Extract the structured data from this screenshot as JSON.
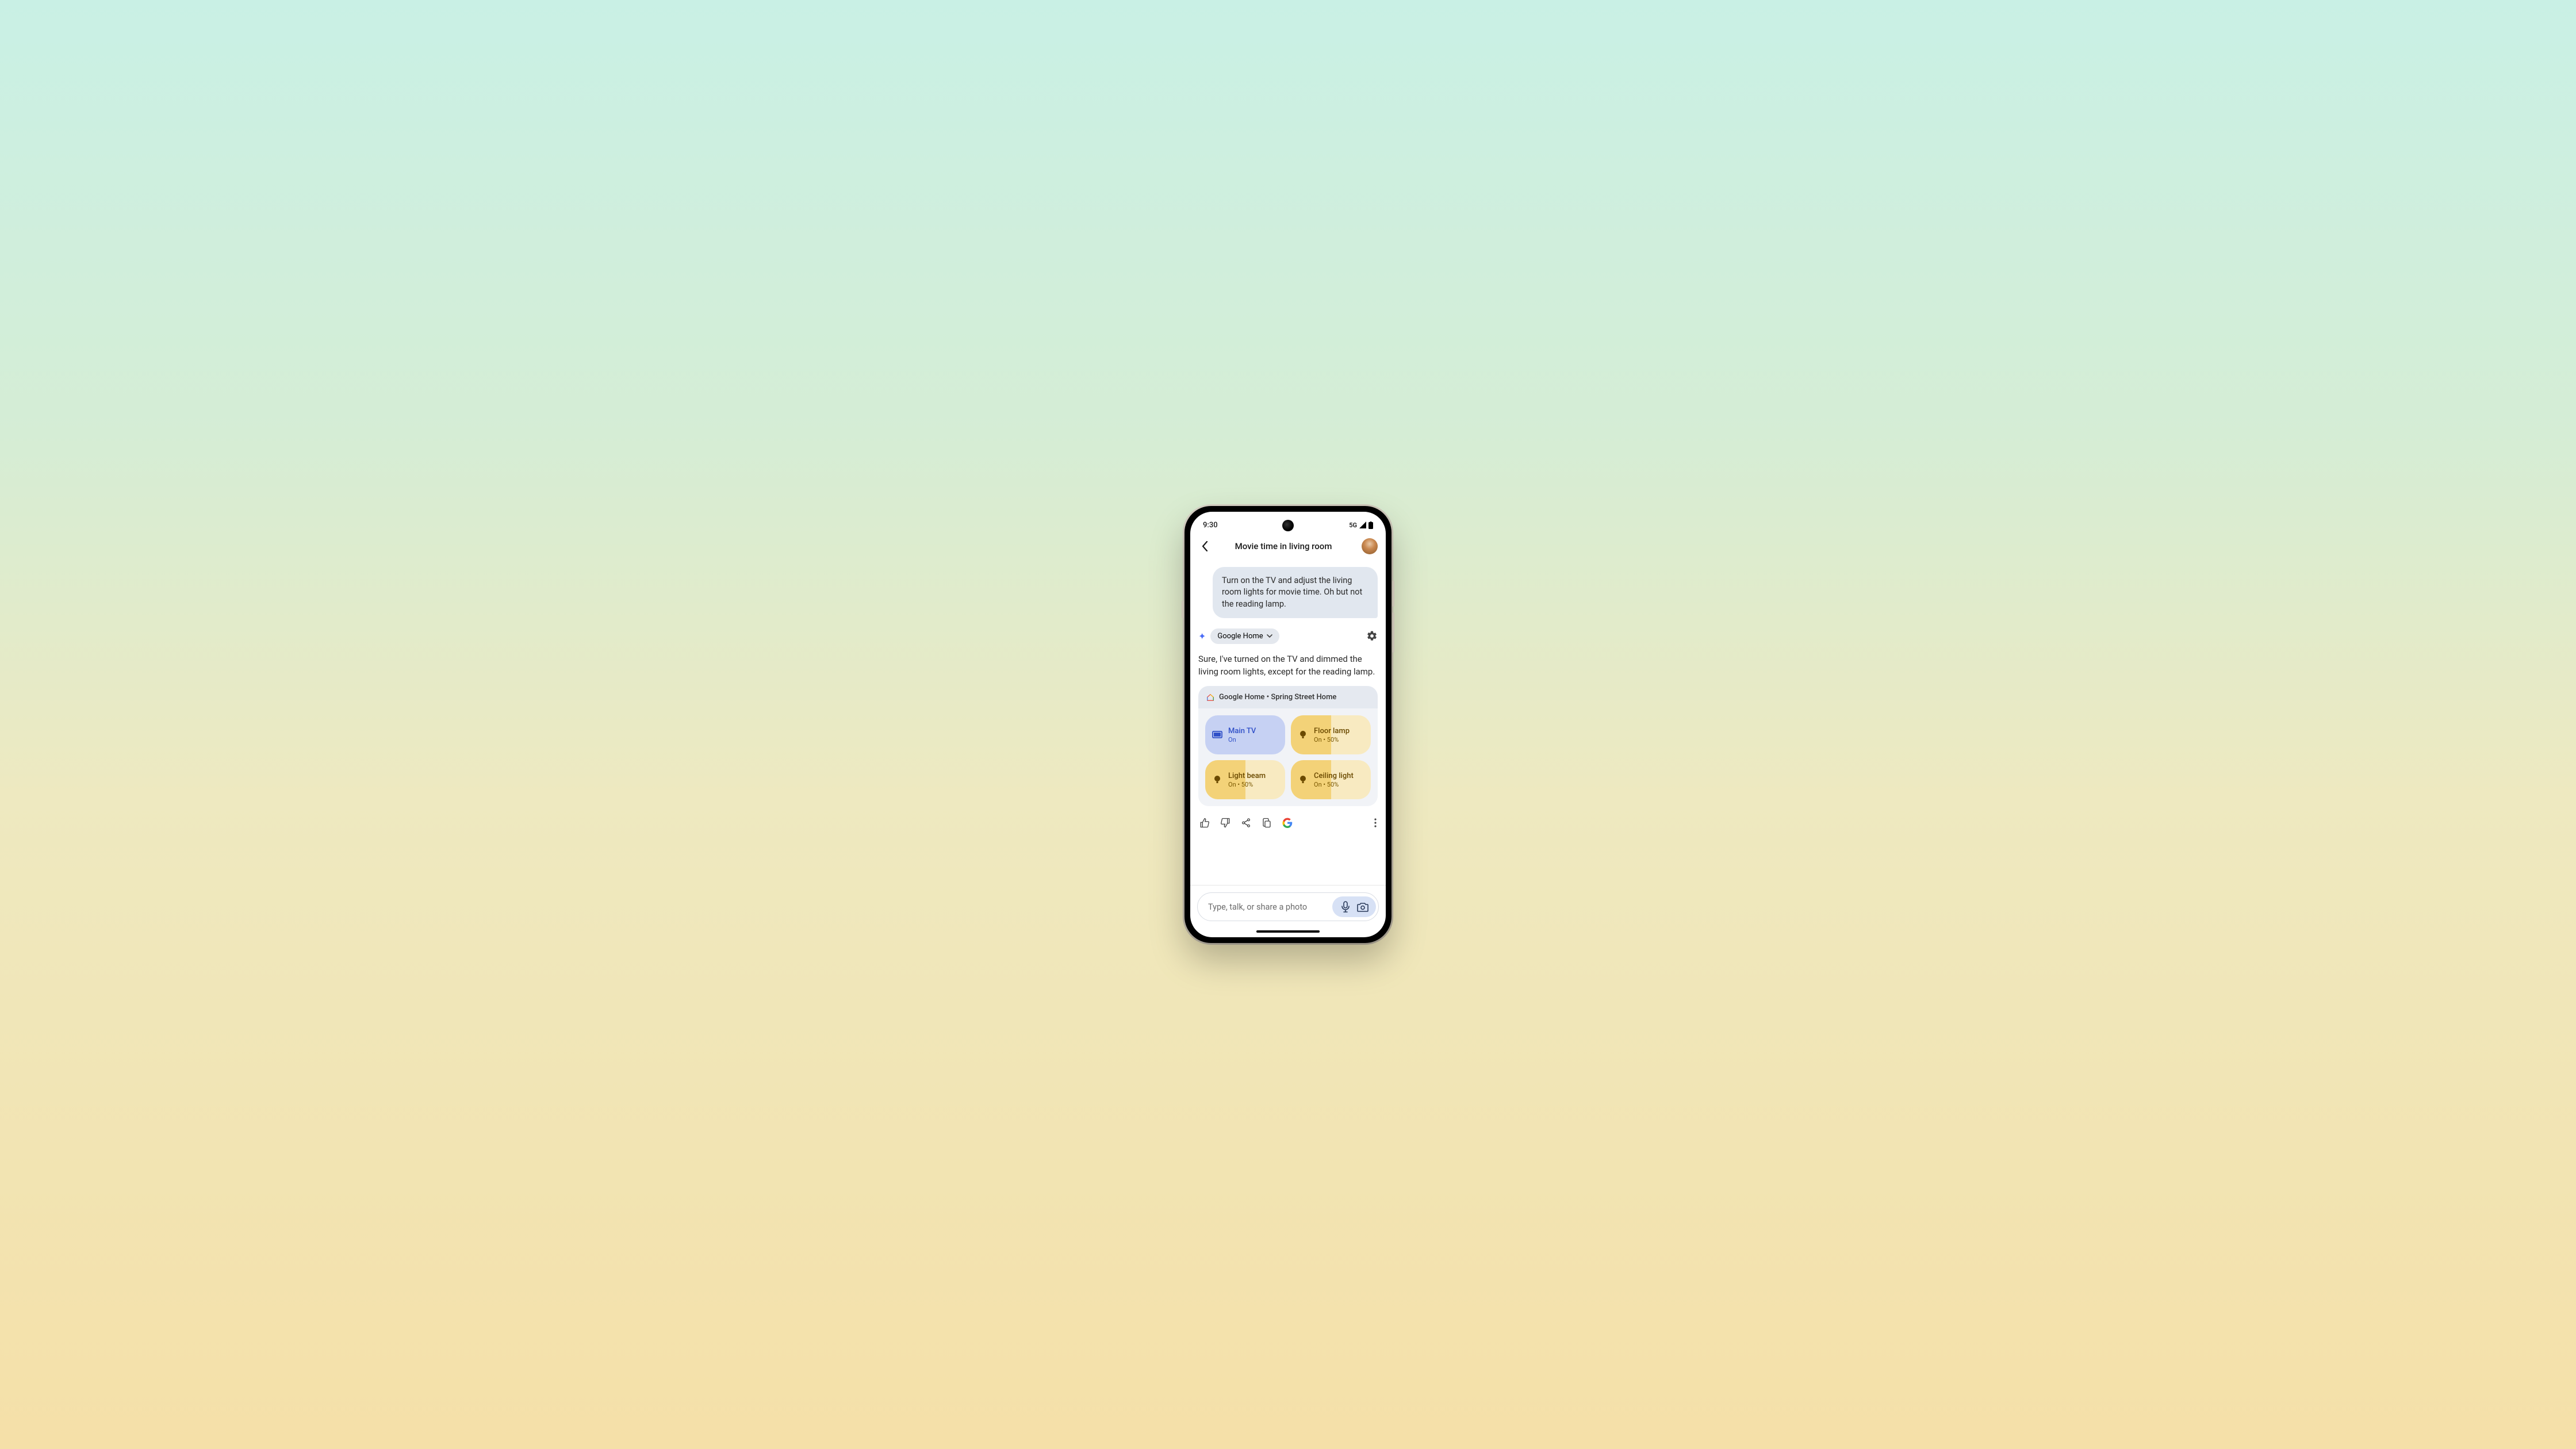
{
  "status": {
    "time": "9:30",
    "network": "5G"
  },
  "header": {
    "title": "Movie time in living room"
  },
  "chat": {
    "user_message": "Turn on the TV and adjust the living room lights for movie time. Oh but not the reading lamp.",
    "source_chip": "Google Home",
    "reply": "Sure, I've turned on the TV and dimmed the living room lights, except for the reading lamp."
  },
  "home_card": {
    "title": "Google Home • Spring Street Home",
    "devices": [
      {
        "name": "Main TV",
        "state": "On",
        "type": "tv"
      },
      {
        "name": "Floor lamp",
        "state": "On • 50%",
        "type": "light"
      },
      {
        "name": "Light beam",
        "state": "On • 50%",
        "type": "light"
      },
      {
        "name": "Ceiling light",
        "state": "On • 50%",
        "type": "light"
      }
    ]
  },
  "input": {
    "placeholder": "Type, talk, or share a photo"
  }
}
